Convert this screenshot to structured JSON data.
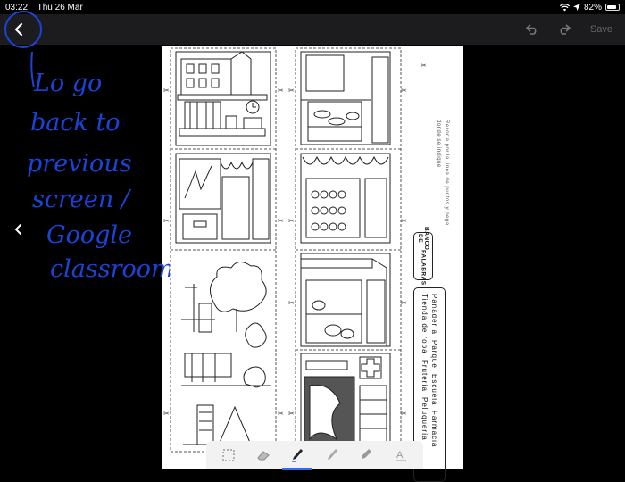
{
  "status_bar": {
    "time": "03:22",
    "date": "Thu 26 Mar",
    "battery_text": "82%",
    "battery_level": 0.82
  },
  "toolbar": {
    "save_label": "Save"
  },
  "annotation": {
    "lines": [
      "Lo go",
      "back to",
      "previous",
      "screen /",
      "Google",
      "classroom"
    ],
    "color": "#1a44d8"
  },
  "worksheet": {
    "instruction_lines": [
      "Recorta por la línea de puntos",
      "y pega donde se indique"
    ],
    "word_bank_title_lines": [
      "BANCO DE",
      "PALABRAS"
    ],
    "word_bank_columns": [
      [
        "Panadería",
        "Parque",
        "Escuela",
        "Farmacia"
      ],
      [
        "Tienda de ropa",
        "Frutería",
        "Peluquería"
      ]
    ]
  },
  "draw_tools": [
    {
      "name": "selection-tool",
      "icon": "dashed-selection-icon"
    },
    {
      "name": "eraser-tool",
      "icon": "eraser-icon"
    },
    {
      "name": "pen-tool",
      "icon": "pen-icon",
      "selected": true
    },
    {
      "name": "pencil-tool",
      "icon": "pencil-icon"
    },
    {
      "name": "marker-tool",
      "icon": "marker-icon"
    },
    {
      "name": "text-tool",
      "icon": "text-icon"
    }
  ]
}
